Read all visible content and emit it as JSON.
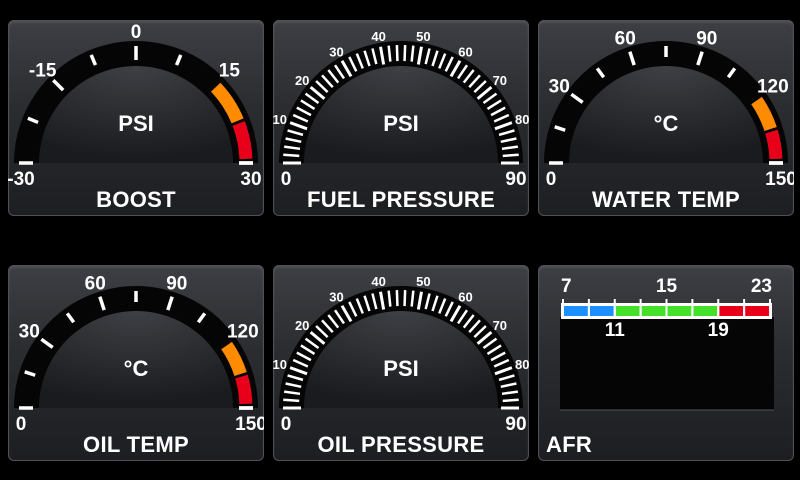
{
  "gauges": [
    {
      "id": "boost",
      "title": "BOOST",
      "unit": "PSI",
      "min": -30,
      "max": 30,
      "type": "boost",
      "labels": [
        "-30",
        "-15",
        "0",
        "15",
        "30"
      ],
      "zones": [
        {
          "color": "#ff8c00"
        },
        {
          "color": "#e8001a"
        }
      ]
    },
    {
      "id": "fuel",
      "title": "FUEL PRESSURE",
      "unit": "PSI",
      "min": 0,
      "max": 90,
      "type": "pressure",
      "labels": [
        "0",
        "10",
        "20",
        "30",
        "40",
        "50",
        "60",
        "70",
        "80",
        "90"
      ]
    },
    {
      "id": "water",
      "title": "WATER TEMP",
      "unit": "°C",
      "min": 0,
      "max": 150,
      "type": "temp",
      "labels": [
        "0",
        "30",
        "60",
        "90",
        "120",
        "150"
      ],
      "zones": [
        {
          "color": "#ff8c00"
        },
        {
          "color": "#e8001a"
        }
      ]
    },
    {
      "id": "oil_temp",
      "title": "OIL TEMP",
      "unit": "°C",
      "min": 0,
      "max": 150,
      "type": "temp",
      "labels": [
        "0",
        "30",
        "60",
        "90",
        "120",
        "150"
      ],
      "zones": [
        {
          "color": "#ff8c00"
        },
        {
          "color": "#e8001a"
        }
      ]
    },
    {
      "id": "oil_press",
      "title": "OIL PRESSURE",
      "unit": "PSI",
      "min": 0,
      "max": 90,
      "type": "pressure",
      "labels": [
        "0",
        "10",
        "20",
        "30",
        "40",
        "50",
        "60",
        "70",
        "80",
        "90"
      ]
    }
  ],
  "afr": {
    "title": "AFR",
    "top_labels": [
      "7",
      "15",
      "23"
    ],
    "bottom_labels": [
      "11",
      "19"
    ],
    "segments": [
      "#1e8fff",
      "#1e8fff",
      "#44e02a",
      "#44e02a",
      "#44e02a",
      "#44e02a",
      "#e8001a",
      "#e8001a"
    ]
  }
}
